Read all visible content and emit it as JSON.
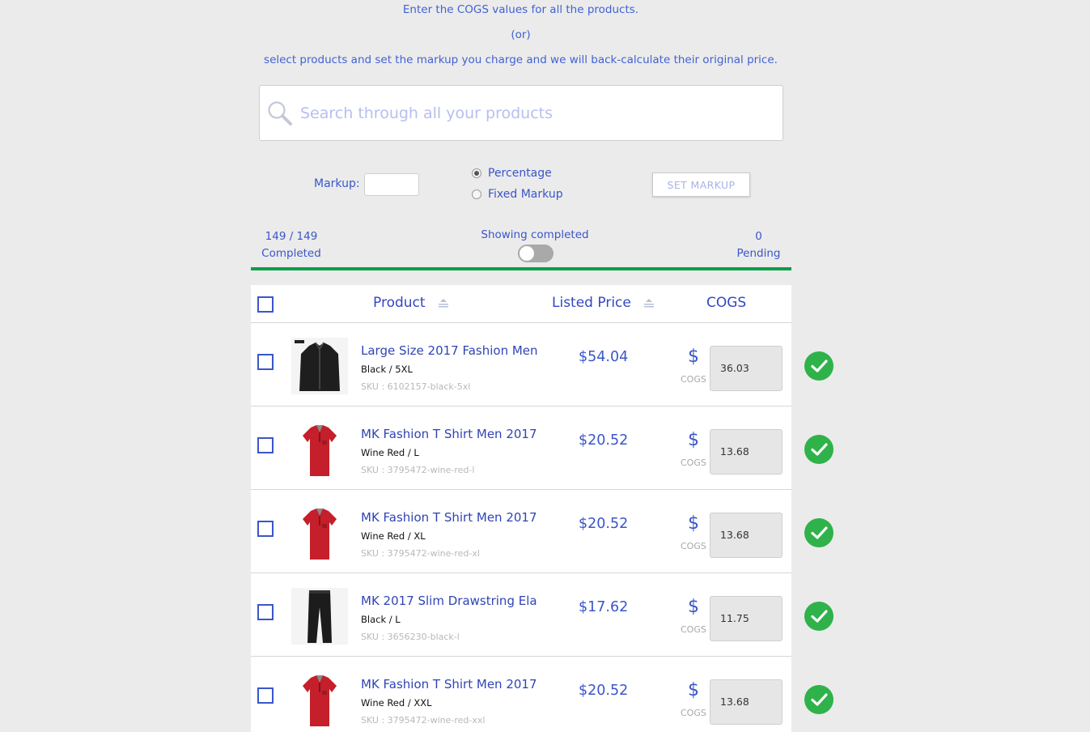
{
  "intro": {
    "line1": "Enter the COGS values for all the products.",
    "line2": "(or)",
    "line3": "select products and set the markup you charge and we will back-calculate their original price."
  },
  "search": {
    "placeholder": "Search through all your products"
  },
  "markup": {
    "label": "Markup:",
    "value": "",
    "options": [
      {
        "label": "Percentage",
        "selected": true
      },
      {
        "label": "Fixed Markup",
        "selected": false
      }
    ],
    "set_button": "SET MARKUP"
  },
  "status": {
    "completed_count": "149 / 149",
    "completed_label": "Completed",
    "toggle_label": "Showing completed",
    "toggle_on": false,
    "pending_count": "0",
    "pending_label": "Pending",
    "progress_percent": 100,
    "progress_color": "#0a9f4a"
  },
  "table": {
    "headers": {
      "product": "Product",
      "listed_price": "Listed Price",
      "cogs": "COGS"
    },
    "rows": [
      {
        "name": "Large Size 2017 Fashion Men",
        "variant": "Black / 5XL",
        "sku": "SKU : 6102157-black-5xl",
        "price": "$54.04",
        "currency": "$",
        "cogs_label": "COGS",
        "cogs": "36.03",
        "image": "jacket-black"
      },
      {
        "name": "MK Fashion T Shirt Men 2017",
        "variant": "Wine Red / L",
        "sku": "SKU : 3795472-wine-red-l",
        "price": "$20.52",
        "currency": "$",
        "cogs_label": "COGS",
        "cogs": "13.68",
        "image": "polo-red"
      },
      {
        "name": "MK Fashion T Shirt Men 2017",
        "variant": "Wine Red / XL",
        "sku": "SKU : 3795472-wine-red-xl",
        "price": "$20.52",
        "currency": "$",
        "cogs_label": "COGS",
        "cogs": "13.68",
        "image": "polo-red"
      },
      {
        "name": "MK 2017 Slim Drawstring Ela",
        "variant": "Black / L",
        "sku": "SKU : 3656230-black-l",
        "price": "$17.62",
        "currency": "$",
        "cogs_label": "COGS",
        "cogs": "11.75",
        "image": "pants-black"
      },
      {
        "name": "MK Fashion T Shirt Men 2017",
        "variant": "Wine Red / XXL",
        "sku": "SKU : 3795472-wine-red-xxl",
        "price": "$20.52",
        "currency": "$",
        "cogs_label": "COGS",
        "cogs": "13.68",
        "image": "polo-red"
      }
    ]
  },
  "colors": {
    "accent": "#3a56c9",
    "success": "#2fb24a"
  }
}
